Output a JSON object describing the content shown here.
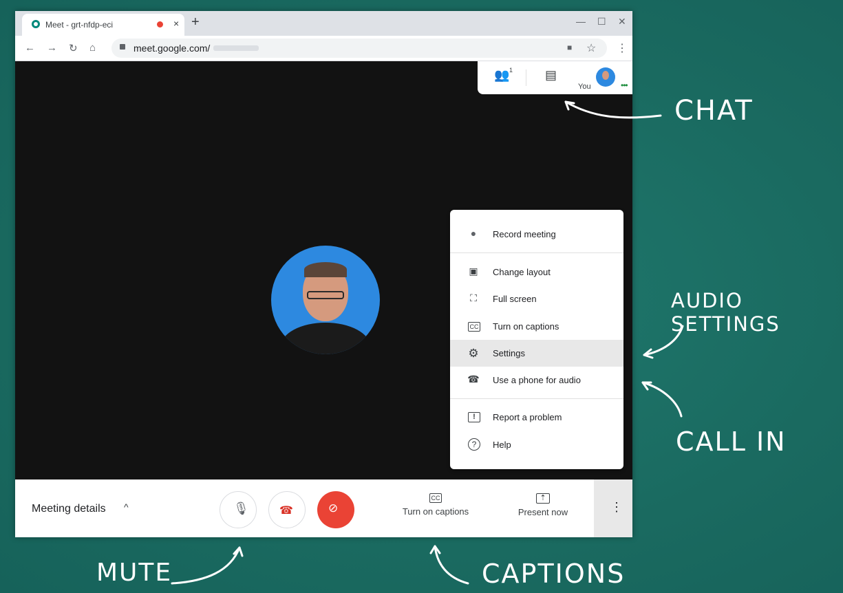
{
  "browser": {
    "tab_title": "Meet - grt-nfdp-eci",
    "tab_close": "×",
    "new_tab": "+",
    "window_controls": [
      "—",
      "☐",
      "✕"
    ],
    "url": "meet.google.com/",
    "nav": {
      "back": "←",
      "forward": "→",
      "reload": "↻",
      "home": "⌂"
    },
    "star": "☆",
    "menu": "⋮",
    "camera_indicator": "■"
  },
  "top_panel": {
    "people_icon": "👥",
    "people_count": "1",
    "chat_icon": "▤",
    "self_label": "You",
    "self_status": "•••"
  },
  "menu": {
    "items": [
      {
        "label": "Record meeting",
        "icon": "●"
      },
      {
        "label": "Change layout",
        "icon": "▣"
      },
      {
        "label": "Full screen",
        "icon": "⛶"
      },
      {
        "label": "Turn on captions",
        "icon": "CC"
      },
      {
        "label": "Settings",
        "icon": "⚙"
      },
      {
        "label": "Use a phone for audio",
        "icon": "☎"
      },
      {
        "label": "Report a problem",
        "icon": "!"
      },
      {
        "label": "Help",
        "icon": "?"
      }
    ]
  },
  "bottom_bar": {
    "meeting_details": "Meeting details",
    "chevron": "^",
    "mic_icon": "🎙",
    "hangup_icon": "☎",
    "camera_off_icon": "⊘",
    "captions_icon": "CC",
    "captions_label": "Turn on captions",
    "present_icon": "⇡",
    "present_label": "Present now",
    "more_icon": "⋮"
  },
  "annotations": {
    "chat": "CHAT",
    "audio_settings": "AUDIO SETTINGS",
    "call_in": "CALL IN",
    "mute": "MUTE",
    "captions": "CAPTIONS"
  }
}
